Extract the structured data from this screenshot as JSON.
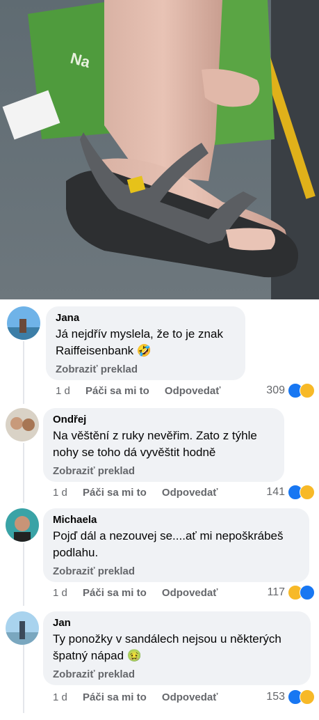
{
  "comments": [
    {
      "author": "Jana",
      "text_lines": [
        "Já nejdřív myslela, že to je znak",
        "Raiffeisenbank 🤣"
      ],
      "translate": "Zobraziť preklad",
      "time": "1 d",
      "like": "Páči sa mi to",
      "reply": "Odpovedať",
      "count": "309",
      "reactions": [
        "like-icon",
        "haha-icon"
      ]
    },
    {
      "author": "Ondřej",
      "text_lines": [
        "Na věštění z ruky nevěřim. Zato z týhle",
        "nohy se toho dá vyvěštit hodně"
      ],
      "translate": "Zobraziť preklad",
      "time": "1 d",
      "like": "Páči sa mi to",
      "reply": "Odpovedať",
      "count": "141",
      "reactions": [
        "like-icon",
        "haha-icon"
      ]
    },
    {
      "author": "Michaela",
      "text_lines": [
        "Pojď dál a nezouvej se....ať mi nepoškrábeš",
        "podlahu."
      ],
      "translate": "Zobraziť preklad",
      "time": "1 d",
      "like": "Páči sa mi to",
      "reply": "Odpovedať",
      "count": "117",
      "reactions": [
        "haha-icon",
        "like-icon"
      ]
    },
    {
      "author": "Jan",
      "text_lines": [
        "Ty ponožky v sandálech nejsou u některých",
        "špatný nápad 🤢"
      ],
      "translate": "Zobraziť preklad",
      "time": "1 d",
      "like": "Páči sa mi to",
      "reply": "Odpovedať",
      "count": "153",
      "reactions": [
        "like-icon",
        "haha-icon"
      ]
    }
  ],
  "colors": {
    "bubble": "#f0f2f5",
    "secondary_text": "#65676b",
    "like_blue": "#1877f2",
    "haha_yellow": "#f7b928"
  }
}
